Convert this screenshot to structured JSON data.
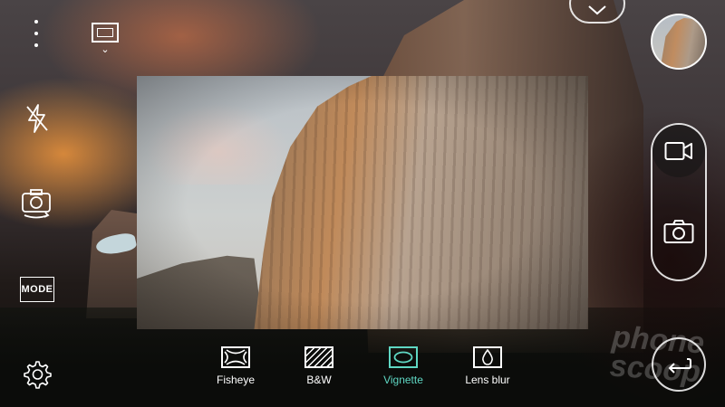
{
  "toolbar": {
    "menu_icon": "more-vertical-icon",
    "aspect_ratio_icon": "aspect-ratio-icon",
    "aspect_ratio_chevron": "⌄",
    "flash_icon": "flash-off-icon",
    "switch_camera_icon": "switch-camera-icon",
    "mode_label": "MODE",
    "settings_icon": "gear-icon"
  },
  "right_panel": {
    "collapse_icon": "chevron-down-icon",
    "gallery_thumbnail": "gallery-thumbnail",
    "video_icon": "video-camera-icon",
    "photo_icon": "camera-icon",
    "back_icon": "back-arrow-icon"
  },
  "filters": {
    "items": [
      {
        "label": "Fisheye",
        "icon": "fisheye-icon"
      },
      {
        "label": "B&W",
        "icon": "bw-icon"
      },
      {
        "label": "Vignette",
        "icon": "vignette-icon",
        "active": true
      },
      {
        "label": "Lens blur",
        "icon": "lens-blur-icon"
      }
    ],
    "active_color": "#5fd7c3"
  },
  "watermark": {
    "line1": "phone",
    "line2": "scoop"
  }
}
